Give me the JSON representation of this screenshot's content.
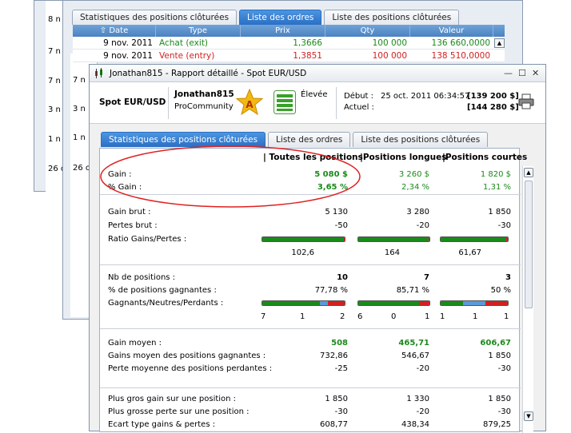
{
  "bg_window": {
    "left_values": [
      "8 n",
      "7 n",
      "7 n",
      "3 n",
      "1 n",
      "26 o"
    ]
  },
  "mid_window": {
    "tabs": [
      "Statistiques des positions clôturées",
      "Liste des ordres",
      "Liste des positions clôturées"
    ],
    "columns": [
      "⇧ Date",
      "Type",
      "Prix",
      "Qty",
      "Valeur"
    ],
    "rows": [
      {
        "date": "9 nov. 2011",
        "type": "Achat (exit)",
        "prix": "1,3666",
        "qty": "100 000",
        "valeur": "136 660,0000"
      },
      {
        "date": "9 nov. 2011",
        "type": "Vente (entry)",
        "prix": "1,3851",
        "qty": "100 000",
        "valeur": "138 510,0000"
      }
    ],
    "left_values": [
      "7 n",
      "7 n",
      "3 n",
      "1 n",
      "26 o"
    ]
  },
  "front_window": {
    "title": "Jonathan815 - Rapport détaillé - Spot EUR/USD",
    "instrument": "Spot EUR/USD",
    "user": "Jonathan815",
    "community": "ProCommunity",
    "rank_letter": "A",
    "risk": "Élevée",
    "debut_label": "Début :",
    "debut_value": "25 oct. 2011 06:34:57",
    "debut_amount": "[139 200 $]",
    "actuel_label": "Actuel :",
    "actuel_amount": "[144 280 $]",
    "tabs": [
      "Statistiques des positions clôturées",
      "Liste des ordres",
      "Liste des positions clôturées"
    ],
    "col_headers": [
      "| Toutes les positions",
      "|Positions longues",
      "|Positions courtes"
    ],
    "gain_label": "Gain :",
    "gain_values": [
      "5 080 $",
      "3 260 $",
      "1 820 $"
    ],
    "pgain_label": "% Gain :",
    "pgain_values": [
      "3,65 %",
      "2,34 %",
      "1,31 %"
    ],
    "gain_brut_label": "Gain brut :",
    "gain_brut_values": [
      "5 130",
      "3 280",
      "1 850"
    ],
    "pertes_brut_label": "Pertes brut :",
    "pertes_brut_values": [
      "-50",
      "-20",
      "-30"
    ],
    "ratio_label": "Ratio Gains/Pertes :",
    "ratio_values": [
      "102,6",
      "164",
      "61,67"
    ],
    "ratio_fill": [
      0.99,
      0.99,
      0.98
    ],
    "nb_label": "Nb de positions :",
    "nb_values": [
      "10",
      "7",
      "3"
    ],
    "pct_gagn_label": "% de positions gagnantes :",
    "pct_gagn_values": [
      "77,78 %",
      "85,71 %",
      "50 %"
    ],
    "gnp_label": "Gagnants/Neutres/Perdants :",
    "gnp_counts": [
      [
        "7",
        "1",
        "2"
      ],
      [
        "6",
        "0",
        "1"
      ],
      [
        "1",
        "1",
        "1"
      ]
    ],
    "gain_moyen_label": "Gain moyen :",
    "gain_moyen_values": [
      "508",
      "465,71",
      "606,67"
    ],
    "gm_gagn_label": "Gains moyen des positions gagnantes :",
    "gm_gagn_values": [
      "732,86",
      "546,67",
      "1 850"
    ],
    "pm_perd_label": "Perte moyenne des positions perdantes :",
    "pm_perd_values": [
      "-25",
      "-20",
      "-30"
    ],
    "gros_gain_label": "Plus gros gain sur une position :",
    "gros_gain_values": [
      "1 850",
      "1 330",
      "1 850"
    ],
    "grosse_perte_label": "Plus grosse perte sur une position :",
    "grosse_perte_values": [
      "-30",
      "-20",
      "-30"
    ],
    "ecart_label": "Ecart type gains & pertes :",
    "ecart_values": [
      "608,77",
      "438,34",
      "879,25"
    ]
  },
  "colors": {
    "green": "#1a8a1a",
    "red": "#d22020",
    "blue": "#5a9ad8",
    "highlight": "#e02020"
  }
}
